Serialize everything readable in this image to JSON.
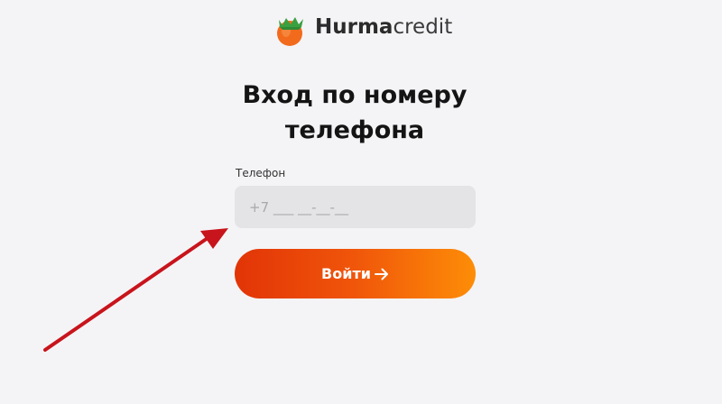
{
  "logo": {
    "brand_bold": "Hurma",
    "brand_light": "credit"
  },
  "login": {
    "title": "Вход по номеру телефона",
    "phone_label": "Телефон",
    "phone_placeholder": "+7 ___ __-__-__",
    "phone_value": "",
    "submit_label": "Войти"
  },
  "icons": {
    "logo": "persimmon-logo-icon",
    "submit": "arrow-right-icon",
    "annotation": "red-pointer-arrow"
  },
  "colors": {
    "button_gradient_start": "#e23407",
    "button_gradient_end": "#fd8d07",
    "annotation": "#c8141c",
    "logo_fruit": "#f26b1d",
    "logo_leaf": "#3aa040"
  }
}
